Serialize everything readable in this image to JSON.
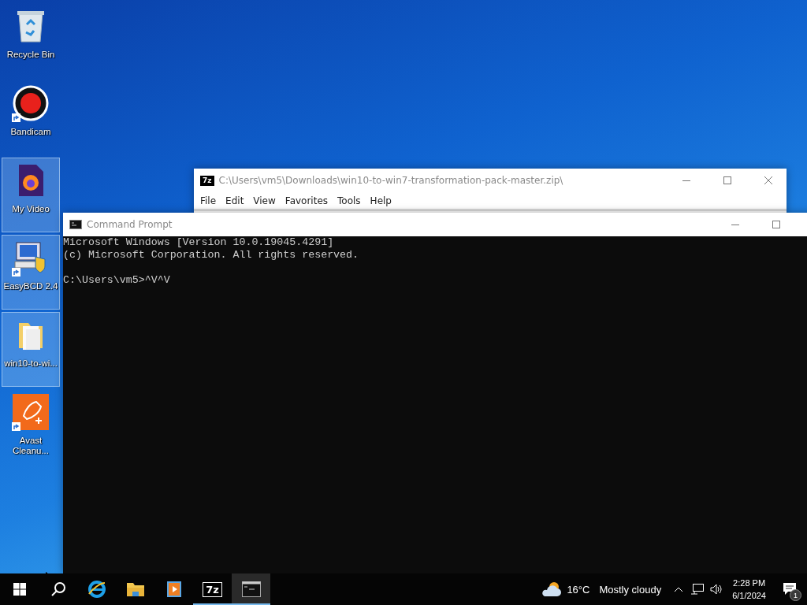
{
  "desktop_icons": [
    {
      "kind": "recycle",
      "label": "Recycle Bin",
      "selected": false,
      "shortcut": false
    },
    {
      "kind": "record",
      "label": "Bandicam",
      "selected": false,
      "shortcut": true
    },
    {
      "kind": "firefox-doc",
      "label": "My Video",
      "selected": true,
      "shortcut": false
    },
    {
      "kind": "easybcd",
      "label": "EasyBCD 2.4",
      "selected": true,
      "shortcut": true
    },
    {
      "kind": "folder",
      "label": "win10-to-wi...",
      "selected": true,
      "shortcut": false
    },
    {
      "kind": "rocket",
      "label": "Avast Cleanu...",
      "selected": false,
      "shortcut": true
    }
  ],
  "archive_window": {
    "title": "C:\\Users\\vm5\\Downloads\\win10-to-win7-transformation-pack-master.zip\\",
    "glyph": "7z",
    "menu": [
      "File",
      "Edit",
      "View",
      "Favorites",
      "Tools",
      "Help"
    ]
  },
  "console_window": {
    "title": "Command Prompt",
    "blocks": [
      {
        "lines": [
          "Microsoft Windows [Version 10.0.19045.4291]",
          "(c) Microsoft Corporation. All rights reserved."
        ]
      },
      {
        "lines": [
          "C:\\Users\\vm5>^V^V"
        ]
      }
    ]
  },
  "taskbar": {
    "apps": [
      {
        "kind": "start",
        "running": false,
        "active": false
      },
      {
        "kind": "search",
        "running": false,
        "active": false
      },
      {
        "kind": "browser",
        "running": false,
        "active": false
      },
      {
        "kind": "explorer",
        "running": false,
        "active": false
      },
      {
        "kind": "media",
        "running": false,
        "active": false
      },
      {
        "kind": "archiver",
        "glyph": "7z",
        "running": true,
        "active": false
      },
      {
        "kind": "console",
        "running": true,
        "active": true
      }
    ],
    "weather": {
      "temperature": "16°C",
      "condition": "Mostly cloudy"
    },
    "clock": {
      "time": "2:28 PM",
      "date": "6/1/2024"
    },
    "notifications": {
      "count": "1"
    }
  }
}
